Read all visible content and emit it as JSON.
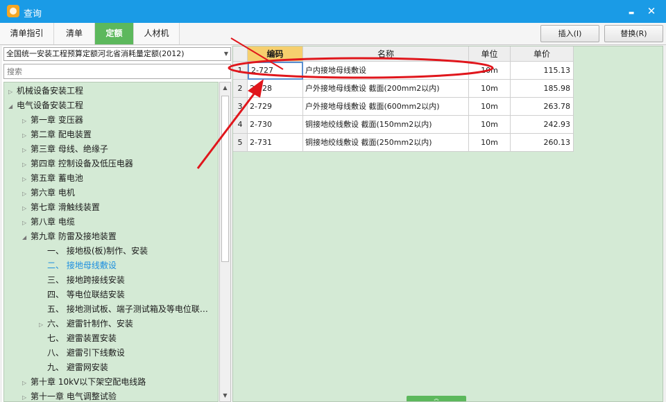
{
  "window": {
    "title": "查询",
    "minimize_glyph": "▬",
    "close_glyph": "✕"
  },
  "tabs": [
    {
      "label": "清单指引",
      "active": false
    },
    {
      "label": "清单",
      "active": false
    },
    {
      "label": "定额",
      "active": true
    },
    {
      "label": "人材机",
      "active": false
    }
  ],
  "actions": {
    "insert_label": "插入(I)",
    "replace_label": "替换(R)"
  },
  "left": {
    "quota_library": "全国统一安装工程预算定额河北省消耗量定额(2012)",
    "search_placeholder": "搜索",
    "tree": [
      {
        "label": "机械设备安装工程",
        "toggle": "▷"
      },
      {
        "label": "电气设备安装工程",
        "toggle": "◢"
      },
      {
        "label": "第一章 变压器",
        "toggle": "▷"
      },
      {
        "label": "第二章 配电装置",
        "toggle": "▷"
      },
      {
        "label": "第三章 母线、绝缘子",
        "toggle": "▷"
      },
      {
        "label": "第四章 控制设备及低压电器",
        "toggle": "▷"
      },
      {
        "label": "第五章 蓄电池",
        "toggle": "▷"
      },
      {
        "label": "第六章 电机",
        "toggle": "▷"
      },
      {
        "label": "第七章 滑触线装置",
        "toggle": "▷"
      },
      {
        "label": "第八章 电缆",
        "toggle": "▷"
      },
      {
        "label": "第九章 防雷及接地装置",
        "toggle": "◢"
      },
      {
        "label": "一、 接地极(板)制作、安装",
        "toggle": ""
      },
      {
        "label": "二、 接地母线敷设",
        "toggle": ""
      },
      {
        "label": "三、 接地跨接线安装",
        "toggle": ""
      },
      {
        "label": "四、 等电位联结安装",
        "toggle": ""
      },
      {
        "label": "五、 接地测试板、端子测试箱及等电位联…",
        "toggle": ""
      },
      {
        "label": "六、 避雷针制作、安装",
        "toggle": "▷"
      },
      {
        "label": "七、 避雷装置安装",
        "toggle": ""
      },
      {
        "label": "八、 避雷引下线敷设",
        "toggle": ""
      },
      {
        "label": "九、 避雷网安装",
        "toggle": ""
      },
      {
        "label": "第十章 10kV以下架空配电线路",
        "toggle": "▷"
      },
      {
        "label": "第十一章 电气调整试验",
        "toggle": "▷"
      }
    ],
    "scroll_up_glyph": "▲",
    "scroll_down_glyph": "▼"
  },
  "table": {
    "headers": [
      "",
      "编码",
      "名称",
      "单位",
      "单价"
    ],
    "rows": [
      {
        "num": "1",
        "code": "2-727",
        "name": "户内接地母线敷设",
        "unit": "10m",
        "price": "115.13"
      },
      {
        "num": "2",
        "code": "2-728",
        "name": "户外接地母线敷设 截面(200mm2以内)",
        "unit": "10m",
        "price": "185.98"
      },
      {
        "num": "3",
        "code": "2-729",
        "name": "户外接地母线敷设 截面(600mm2以内)",
        "unit": "10m",
        "price": "263.78"
      },
      {
        "num": "4",
        "code": "2-730",
        "name": "铜接地绞线敷设 截面(150mm2以内)",
        "unit": "10m",
        "price": "242.93"
      },
      {
        "num": "5",
        "code": "2-731",
        "name": "铜接地绞线敷设 截面(250mm2以内)",
        "unit": "10m",
        "price": "260.13"
      }
    ],
    "splitter_glyph": "︽"
  },
  "colors": {
    "title_bar": "#1a9be6",
    "active_tab": "#5cb85c",
    "panel_green": "#d4ead5",
    "annotation_red": "#e0161c",
    "selected_header": "#f6cf6e",
    "selected_tree_item": "#1d8fe0"
  }
}
